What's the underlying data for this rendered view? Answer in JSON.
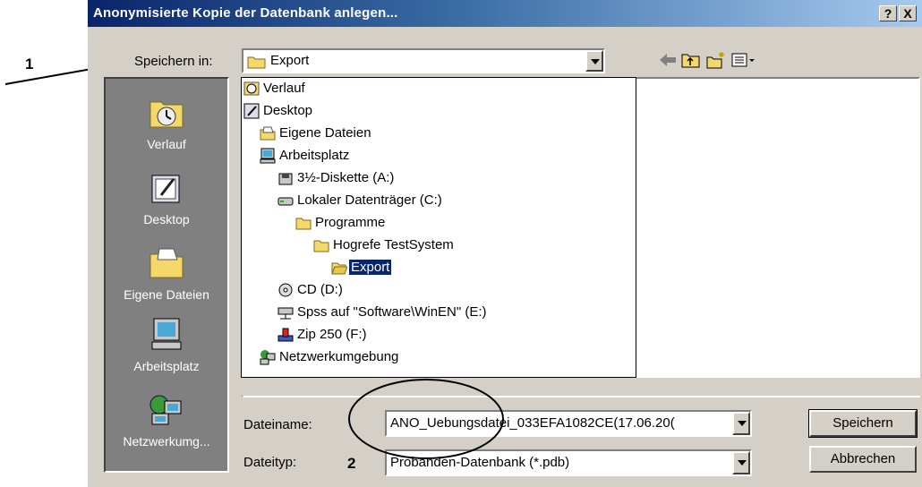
{
  "dialog": {
    "title": "Anonymisierte Kopie der Datenbank anlegen...",
    "help_label": "?",
    "close_label": "X"
  },
  "location": {
    "label": "Speichern in:",
    "value": "Export"
  },
  "places": [
    {
      "label": "Verlauf",
      "icon": "history-icon"
    },
    {
      "label": "Desktop",
      "icon": "desktop-icon"
    },
    {
      "label": "Eigene Dateien",
      "icon": "my-documents-icon"
    },
    {
      "label": "Arbeitsplatz",
      "icon": "my-computer-icon"
    },
    {
      "label": "Netzwerkumg...",
      "icon": "network-icon"
    }
  ],
  "dropdown": [
    {
      "label": "Verlauf",
      "icon": "history-icon",
      "level": 0
    },
    {
      "label": "Desktop",
      "icon": "desktop-icon",
      "level": 0
    },
    {
      "label": "Eigene Dateien",
      "icon": "my-documents-icon",
      "level": 1
    },
    {
      "label": "Arbeitsplatz",
      "icon": "my-computer-icon",
      "level": 1
    },
    {
      "label": "3½-Diskette (A:)",
      "icon": "floppy-icon",
      "level": 2
    },
    {
      "label": "Lokaler Datenträger (C:)",
      "icon": "hard-drive-icon",
      "level": 2
    },
    {
      "label": "Programme",
      "icon": "folder-icon",
      "level": 3
    },
    {
      "label": "Hogrefe TestSystem",
      "icon": "folder-icon",
      "level": 4
    },
    {
      "label": "Export",
      "icon": "open-folder-icon",
      "level": 5,
      "selected": true
    },
    {
      "label": "CD (D:)",
      "icon": "cd-drive-icon",
      "level": 2
    },
    {
      "label": "Spss auf \"Software\\WinEN\" (E:)",
      "icon": "network-drive-icon",
      "level": 2
    },
    {
      "label": "Zip 250  (F:)",
      "icon": "zip-drive-icon",
      "level": 2
    },
    {
      "label": "Netzwerkumgebung",
      "icon": "network-icon",
      "level": 1
    }
  ],
  "filename": {
    "label": "Dateiname:",
    "value": "ANO_Uebungsdatei_033EFA1082CE(17.06.20("
  },
  "filetype": {
    "label": "Dateityp:",
    "value": "Probanden-Datenbank (*.pdb)"
  },
  "buttons": {
    "save": "Speichern",
    "cancel": "Abbrechen"
  },
  "annotations": {
    "marker1": "1",
    "marker2": "2"
  }
}
